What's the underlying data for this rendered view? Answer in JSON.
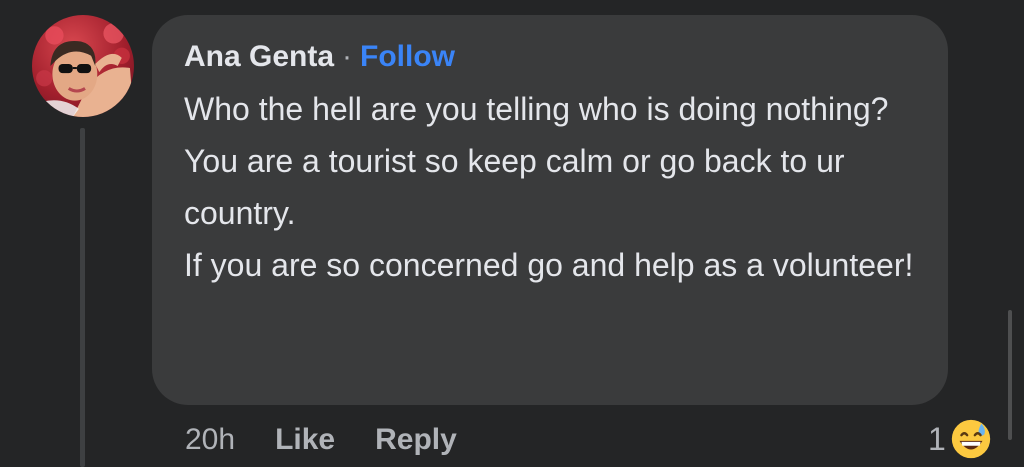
{
  "comment": {
    "author": "Ana Genta",
    "separator": "·",
    "follow_label": "Follow",
    "lines": [
      "Who the hell are you telling who is doing nothing?",
      "You are a tourist so keep calm or go back to ur country.",
      "If you are so concerned go and help as a volunteer!"
    ],
    "time": "20h",
    "like_label": "Like",
    "reply_label": "Reply",
    "reaction_count": "1",
    "reaction_icon": "grinning-sweat-emoji-icon"
  },
  "colors": {
    "background": "#242526",
    "bubble": "#3a3b3c",
    "text": "#e4e6eb",
    "muted": "#b0b3b8",
    "link": "#3a84f7"
  }
}
